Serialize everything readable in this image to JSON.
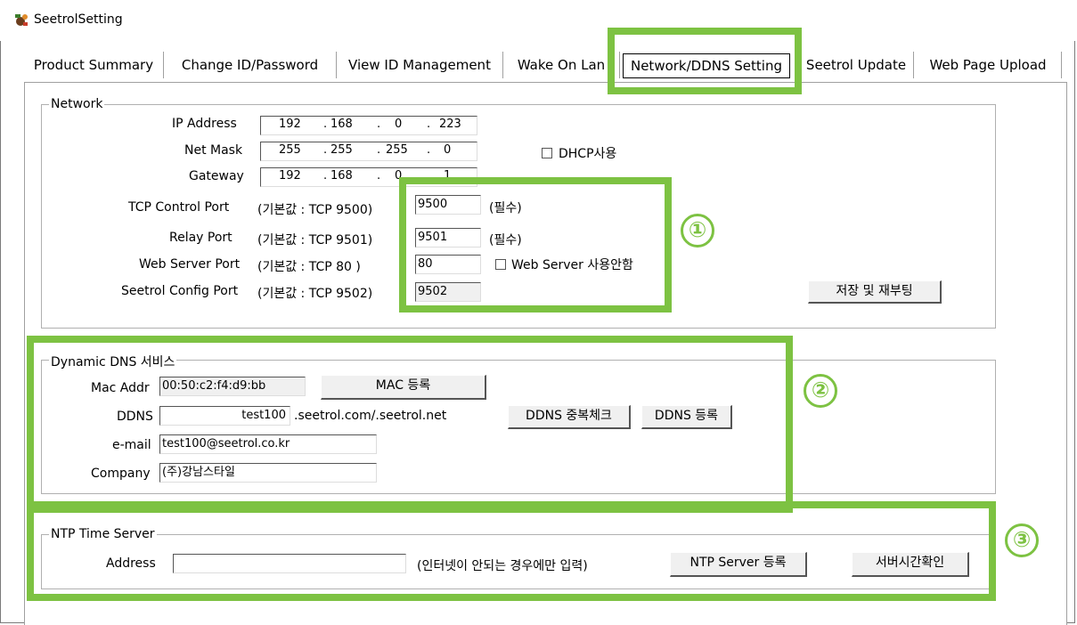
{
  "window": {
    "title": "SeetrolSetting",
    "icon": "seetrol-app-icon"
  },
  "tabs": [
    {
      "label": "Product Summary"
    },
    {
      "label": "Change ID/Password"
    },
    {
      "label": "View ID Management"
    },
    {
      "label": "Wake On Lan"
    },
    {
      "label": "Network/DDNS Setting",
      "active": true
    },
    {
      "label": "Seetrol Update"
    },
    {
      "label": "Web Page Upload"
    }
  ],
  "network": {
    "legend": "Network",
    "ip_label": "IP Address",
    "ip": [
      "192",
      "168",
      "0",
      "223"
    ],
    "mask_label": "Net Mask",
    "mask": [
      "255",
      "255",
      "255",
      "0"
    ],
    "gateway_label": "Gateway",
    "gateway": [
      "192",
      "168",
      "0",
      "1"
    ],
    "dhcp_label": "DHCP사용",
    "tcp_label": "TCP Control Port",
    "tcp_default": "(기본값 : TCP 9500)",
    "tcp_value": "9500",
    "tcp_note": "(필수)",
    "relay_label": "Relay Port",
    "relay_default": "(기본값 : TCP 9501)",
    "relay_value": "9501",
    "relay_note": "(필수)",
    "web_label": "Web Server Port",
    "web_default": "(기본값 : TCP 80  )",
    "web_value": "80",
    "web_disable_label": "Web Server 사용안함",
    "config_label": "Seetrol Config Port",
    "config_default": "(기본값 : TCP 9502)",
    "config_value": "9502",
    "save_button": "저장 및 재부팅"
  },
  "ddns": {
    "legend": "Dynamic DNS 서비스",
    "mac_label": "Mac Addr",
    "mac_value": "00:50:c2:f4:d9:bb",
    "mac_button": "MAC 등록",
    "ddns_label": "DDNS",
    "ddns_value": "test100",
    "ddns_suffix": ".seetrol.com/.seetrol.net",
    "dup_button": "DDNS 중복체크",
    "reg_button": "DDNS 등록",
    "email_label": "e-mail",
    "email_value": "test100@seetrol.co.kr",
    "company_label": "Company",
    "company_value": "(주)강남스타일"
  },
  "ntp": {
    "legend": "NTP Time Server",
    "address_label": "Address",
    "address_value": "",
    "note": "(인터넷이 안되는 경우에만 입력)",
    "reg_button": "NTP Server 등록",
    "check_button": "서버시간확인"
  },
  "annotations": {
    "highlight_color": "#7dc242",
    "markers": [
      "①",
      "②",
      "③"
    ]
  }
}
